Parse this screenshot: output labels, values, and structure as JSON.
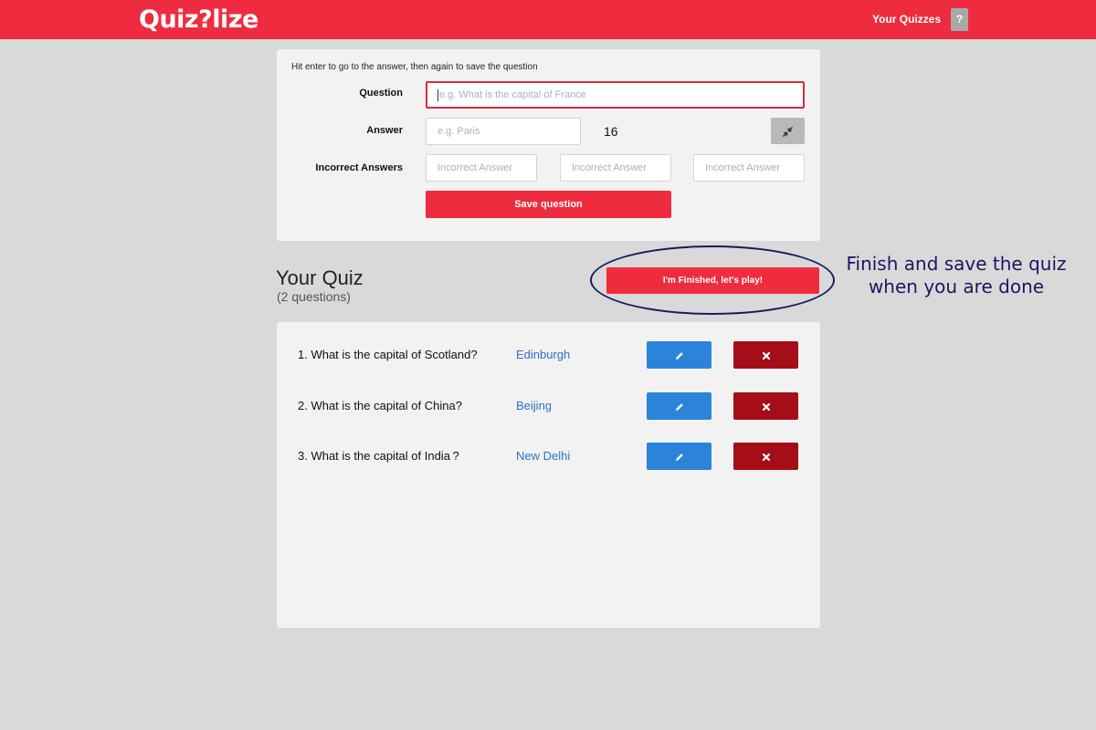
{
  "header": {
    "logo": "Quiz?lize",
    "nav_link": "Your Quizzes",
    "help": "?"
  },
  "form": {
    "hint": "Hit enter to go to the answer, then again to save the question",
    "question_label": "Question",
    "question_placeholder": "e.g. What is the capital of France",
    "answer_label": "Answer",
    "answer_placeholder": "e.g. Paris",
    "char_count": "16",
    "incorrect_label": "Incorrect Answers",
    "incorrect_placeholders": [
      "Incorrect Answer",
      "Incorrect Answer",
      "Incorrect Answer"
    ],
    "save_label": "Save question"
  },
  "quiz": {
    "title": "Your Quiz",
    "count": "(2 questions)",
    "finish_label": "I'm Finished, let's play!",
    "annotation_line1": "Finish and save the quiz",
    "annotation_line2": "when you are done",
    "questions": [
      {
        "text": "1. What is the capital of Scotland?",
        "answer": "Edinburgh"
      },
      {
        "text": "2. What is the capital of China?",
        "answer": "Beijing"
      },
      {
        "text": "3. What is the capital of  India ?",
        "answer": "New Delhi"
      }
    ]
  },
  "icons": {
    "edit": "pencil-icon",
    "delete": "close-icon",
    "shrink": "compress-icon"
  },
  "colors": {
    "brand_red": "#ef2c3f",
    "edit_blue": "#2b84d9",
    "delete_red": "#a50e18",
    "answer_blue": "#2a72c5",
    "annotation_navy": "#1a1860"
  }
}
